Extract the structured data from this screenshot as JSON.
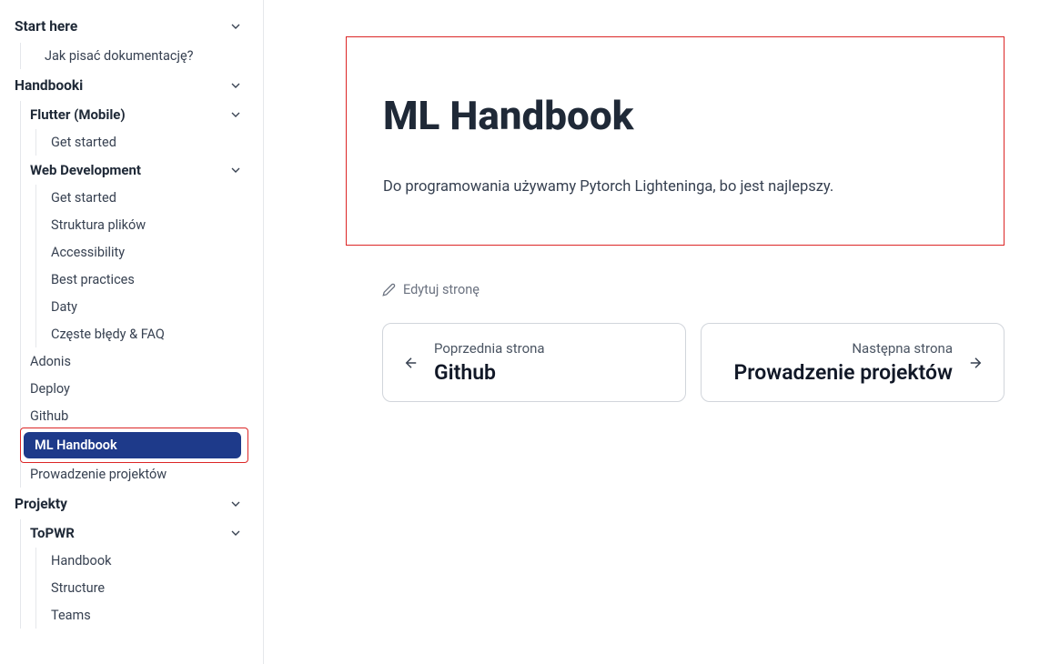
{
  "sidebar": {
    "start_here": "Start here",
    "jak_pisac": "Jak pisać dokumentację?",
    "handbooki": "Handbooki",
    "flutter": "Flutter (Mobile)",
    "flutter_getstarted": "Get started",
    "webdev": "Web Development",
    "webdev_getstarted": "Get started",
    "struktura": "Struktura plików",
    "accessibility": "Accessibility",
    "best_practices": "Best practices",
    "daty": "Daty",
    "faq": "Częste błędy & FAQ",
    "adonis": "Adonis",
    "deploy": "Deploy",
    "github": "Github",
    "ml_handbook": "ML Handbook",
    "prowadzenie": "Prowadzenie projektów",
    "projekty": "Projekty",
    "topwr": "ToPWR",
    "handbook": "Handbook",
    "structure": "Structure",
    "teams": "Teams"
  },
  "page": {
    "title": "ML Handbook",
    "body": "Do programowania używamy Pytorch Lighteninga, bo jest najlepszy.",
    "edit": "Edytuj stronę"
  },
  "nav": {
    "prev_label": "Poprzednia strona",
    "prev_title": "Github",
    "next_label": "Następna strona",
    "next_title": "Prowadzenie projektów"
  }
}
